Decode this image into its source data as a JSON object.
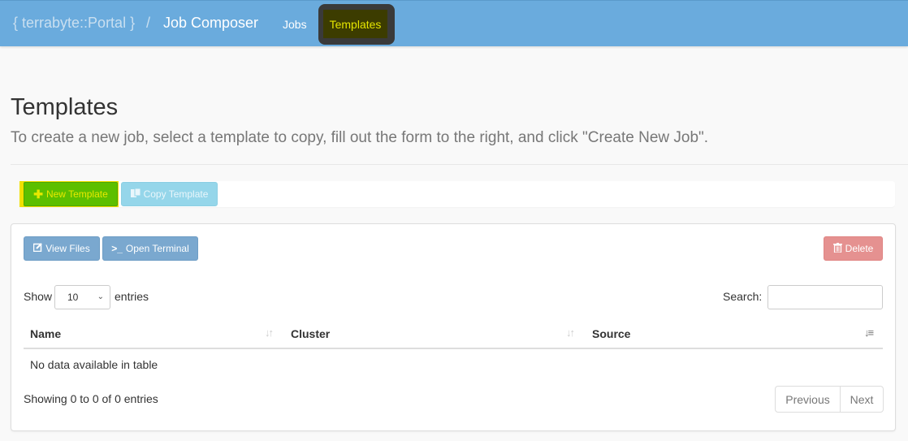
{
  "navbar": {
    "brand": "{ terrabyte::Portal }",
    "separator": "/",
    "app_title": "Job Composer",
    "links": [
      {
        "label": "Jobs",
        "active": false
      },
      {
        "label": "Templates",
        "active": true
      }
    ]
  },
  "page": {
    "title": "Templates",
    "subtitle": "To create a new job, select a template to copy, fill out the form to the right, and click \"Create New Job\"."
  },
  "toolbar": {
    "new_template_label": "New Template",
    "new_template_icon": "plus-icon",
    "copy_template_label": "Copy Template",
    "copy_template_icon": "copy-icon"
  },
  "panel": {
    "view_files_label": "View Files",
    "view_files_icon": "edit-icon",
    "open_terminal_label": "Open Terminal",
    "open_terminal_icon": "terminal-icon",
    "delete_label": "Delete",
    "delete_icon": "trash-icon"
  },
  "table_controls": {
    "show_label": "Show",
    "page_length": "10",
    "entries_label": "entries",
    "search_label": "Search:",
    "search_value": ""
  },
  "table": {
    "columns": [
      {
        "label": "Name",
        "sort": "both"
      },
      {
        "label": "Cluster",
        "sort": "both"
      },
      {
        "label": "Source",
        "sort": "desc"
      }
    ],
    "rows": [],
    "empty_message": "No data available in table",
    "info": "Showing 0 to 0 of 0 entries"
  },
  "pagination": {
    "previous_label": "Previous",
    "next_label": "Next"
  },
  "colors": {
    "navbar": "#6aabdd",
    "new_template": "#5cbf00",
    "copy_template": "#95d6ea",
    "primary_small": "#7aa8cf",
    "delete": "#e59190"
  }
}
